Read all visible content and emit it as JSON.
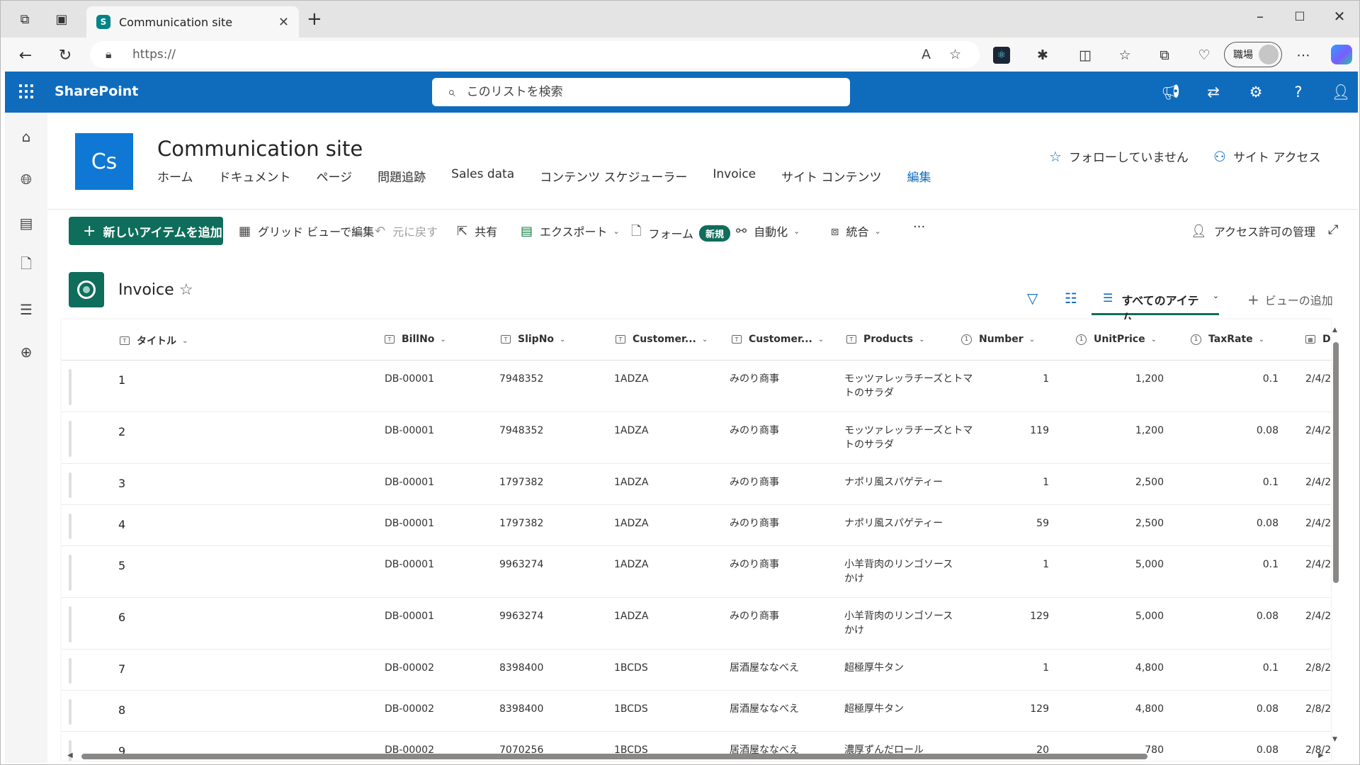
{
  "browser": {
    "tab_title": "Communication site",
    "tab_favicon": "S",
    "url": "https://",
    "profile_label": "職場"
  },
  "suite": {
    "app_name": "SharePoint",
    "search_placeholder": "このリストを検索"
  },
  "site": {
    "logo_text": "Cs",
    "title": "Communication site",
    "nav": [
      "ホーム",
      "ドキュメント",
      "ページ",
      "問題追跡",
      "Sales data",
      "コンテンツ スケジューラー",
      "Invoice",
      "サイト コンテンツ",
      "編集"
    ],
    "follow_label": "フォローしていません",
    "site_access_label": "サイト アクセス"
  },
  "commands": {
    "new_item": "新しいアイテムを追加",
    "grid_edit": "グリッド ビューで編集",
    "undo": "元に戻す",
    "share": "共有",
    "export": "エクスポート",
    "forms": "フォーム",
    "forms_badge": "新規",
    "automate": "自動化",
    "integrate": "統合",
    "more": "···",
    "manage_access": "アクセス許可の管理"
  },
  "list": {
    "title": "Invoice",
    "view_name": "すべてのアイテム",
    "add_view": "ビューの追加",
    "columns": [
      "タイトル",
      "BillNo",
      "SlipNo",
      "Customer...",
      "Customer...",
      "Products",
      "Number",
      "UnitPrice",
      "TaxRate",
      "D"
    ],
    "rows": [
      {
        "title": "1",
        "billno": "DB-00001",
        "slipno": "7948352",
        "cust_code": "1ADZA",
        "cust_name": "みのり商事",
        "products": [
          "モッツァレッラチーズとトマ",
          "トのサラダ"
        ],
        "number": "1",
        "unitprice": "1,200",
        "taxrate": "0.1",
        "date": "2/4/2"
      },
      {
        "title": "2",
        "billno": "DB-00001",
        "slipno": "7948352",
        "cust_code": "1ADZA",
        "cust_name": "みのり商事",
        "products": [
          "モッツァレッラチーズとトマ",
          "トのサラダ"
        ],
        "number": "119",
        "unitprice": "1,200",
        "taxrate": "0.08",
        "date": "2/4/2"
      },
      {
        "title": "3",
        "billno": "DB-00001",
        "slipno": "1797382",
        "cust_code": "1ADZA",
        "cust_name": "みのり商事",
        "products": [
          "ナポリ風スパゲティー"
        ],
        "number": "1",
        "unitprice": "2,500",
        "taxrate": "0.1",
        "date": "2/4/2"
      },
      {
        "title": "4",
        "billno": "DB-00001",
        "slipno": "1797382",
        "cust_code": "1ADZA",
        "cust_name": "みのり商事",
        "products": [
          "ナポリ風スパゲティー"
        ],
        "number": "59",
        "unitprice": "2,500",
        "taxrate": "0.08",
        "date": "2/4/2"
      },
      {
        "title": "5",
        "billno": "DB-00001",
        "slipno": "9963274",
        "cust_code": "1ADZA",
        "cust_name": "みのり商事",
        "products": [
          "小羊背肉のリンゴソース",
          "かけ"
        ],
        "number": "1",
        "unitprice": "5,000",
        "taxrate": "0.1",
        "date": "2/4/2"
      },
      {
        "title": "6",
        "billno": "DB-00001",
        "slipno": "9963274",
        "cust_code": "1ADZA",
        "cust_name": "みのり商事",
        "products": [
          "小羊背肉のリンゴソース",
          "かけ"
        ],
        "number": "129",
        "unitprice": "5,000",
        "taxrate": "0.08",
        "date": "2/4/2"
      },
      {
        "title": "7",
        "billno": "DB-00002",
        "slipno": "8398400",
        "cust_code": "1BCDS",
        "cust_name": "居酒屋ななべえ",
        "products": [
          "超極厚牛タン"
        ],
        "number": "1",
        "unitprice": "4,800",
        "taxrate": "0.1",
        "date": "2/8/2"
      },
      {
        "title": "8",
        "billno": "DB-00002",
        "slipno": "8398400",
        "cust_code": "1BCDS",
        "cust_name": "居酒屋ななべえ",
        "products": [
          "超極厚牛タン"
        ],
        "number": "129",
        "unitprice": "4,800",
        "taxrate": "0.08",
        "date": "2/8/2"
      },
      {
        "title": "9",
        "billno": "DB-00002",
        "slipno": "7070256",
        "cust_code": "1BCDS",
        "cust_name": "居酒屋ななべえ",
        "products": [
          "濃厚ずんだロール"
        ],
        "number": "20",
        "unitprice": "780",
        "taxrate": "0.08",
        "date": "2/8/2"
      }
    ]
  }
}
